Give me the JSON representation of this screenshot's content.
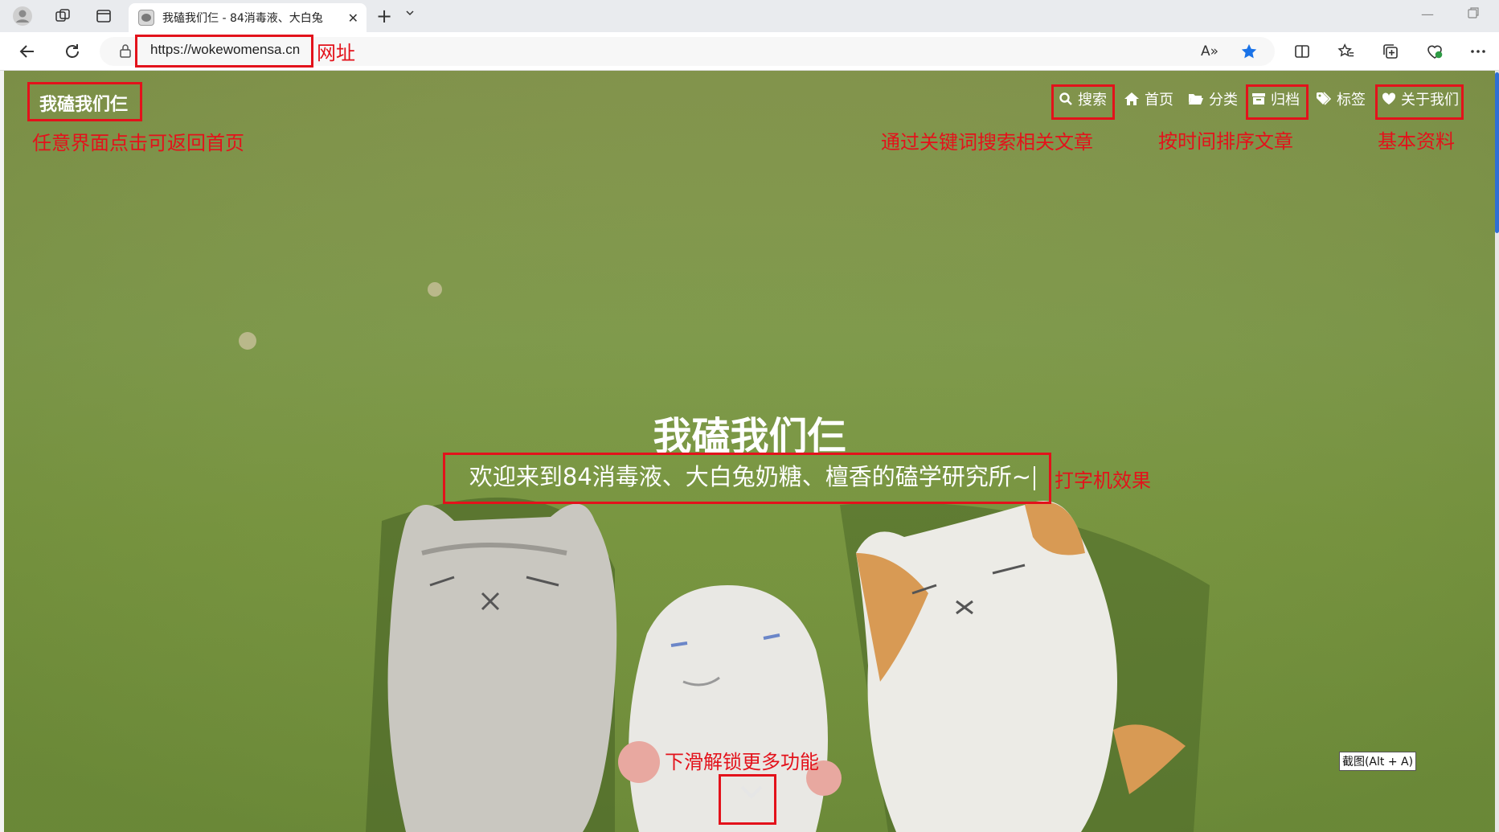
{
  "browser": {
    "tab_title": "我磕我们仨 - 84消毒液、大白兔",
    "url": "https://wokewomensa.cn",
    "read_aloud_label": "A»"
  },
  "site": {
    "brand": "我磕我们仨",
    "menu": [
      {
        "label": "搜索",
        "icon": "search-icon"
      },
      {
        "label": "首页",
        "icon": "home-icon"
      },
      {
        "label": "分类",
        "icon": "folder-icon"
      },
      {
        "label": "归档",
        "icon": "archive-icon"
      },
      {
        "label": "标签",
        "icon": "tag-icon"
      },
      {
        "label": "关于我们",
        "icon": "heart-icon"
      }
    ],
    "hero_title": "我磕我们仨",
    "hero_subtitle": "欢迎来到84消毒液、大白兔奶糖、檀香的磕学研究所~",
    "scroll_down_icon": "chevron-down-icon"
  },
  "annotations": {
    "url_note": "网址",
    "brand_note": "任意界面点击可返回首页",
    "search_note": "通过关键词搜索相关文章",
    "archive_note": "按时间排序文章",
    "about_note": "基本资料",
    "typewriter_note": "打字机效果",
    "scroll_note": "下滑解锁更多功能"
  },
  "tooltip": "截图(Alt + A)",
  "colors": {
    "annotation_red": "#e3121b",
    "background_green": "#7f9a4c",
    "favorite_star": "#1a73e8"
  }
}
